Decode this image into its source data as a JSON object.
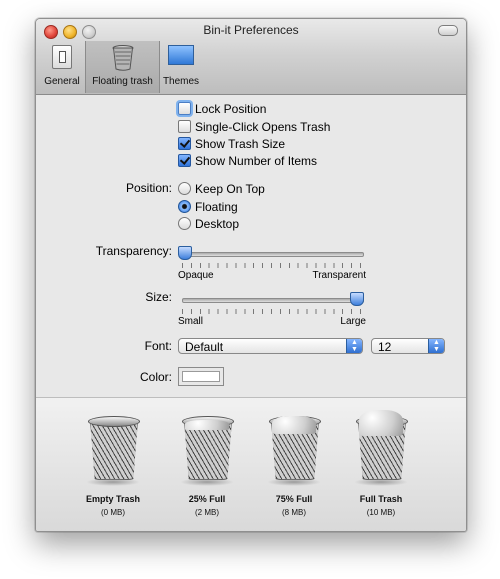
{
  "window": {
    "title": "Bin-it Preferences"
  },
  "toolbar": {
    "items": [
      {
        "label": "General",
        "icon": "switch-icon"
      },
      {
        "label": "Floating trash",
        "icon": "trash-can-icon",
        "selected": true
      },
      {
        "label": "Themes",
        "icon": "monitor-icon"
      }
    ]
  },
  "options": {
    "checkboxes": [
      {
        "label": "Lock Position",
        "checked": false
      },
      {
        "label": "Single-Click Opens Trash",
        "checked": false
      },
      {
        "label": "Show Trash Size",
        "checked": true
      },
      {
        "label": "Show Number of Items",
        "checked": true
      }
    ],
    "position": {
      "label": "Position:",
      "options": [
        {
          "label": "Keep On Top",
          "selected": false
        },
        {
          "label": "Floating",
          "selected": true
        },
        {
          "label": "Desktop",
          "selected": false
        }
      ]
    },
    "transparency": {
      "label": "Transparency:",
      "min_label": "Opaque",
      "max_label": "Transparent",
      "value": 0
    },
    "size": {
      "label": "Size:",
      "min_label": "Small",
      "max_label": "Large",
      "value": 1
    },
    "font": {
      "label": "Font:",
      "family": "Default",
      "size": "12"
    },
    "color": {
      "label": "Color:",
      "value": "#ffffff"
    }
  },
  "previews": [
    {
      "name": "Empty Trash",
      "size": "(0 MB)",
      "fill": 0
    },
    {
      "name": "25% Full",
      "size": "(2 MB)",
      "fill": 0.25
    },
    {
      "name": "75% Full",
      "size": "(8 MB)",
      "fill": 0.75
    },
    {
      "name": "Full Trash",
      "size": "(10 MB)",
      "fill": 1
    }
  ],
  "colors": {
    "accent": "#2f73d9",
    "window_bg": "#e8e8e8"
  }
}
